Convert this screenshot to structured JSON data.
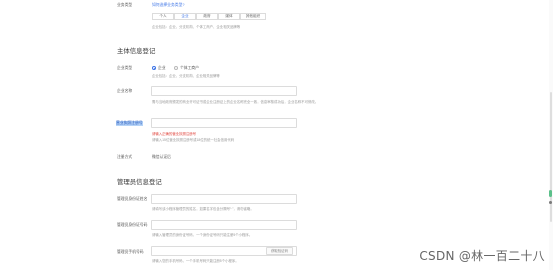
{
  "scene": {
    "business_type": {
      "label": "业务类型",
      "link": "如何选择业务类型?",
      "options": [
        "个人",
        "企业",
        "政府",
        "媒体",
        "其他组织"
      ],
      "help": "企业包括：企业、分支机构、个体工商户、企业相关品牌等"
    },
    "subject_section": {
      "title": "主体信息登记",
      "type_label": "企业类型",
      "type_options": [
        "企业",
        "个体工商户"
      ],
      "type_help": "企业包括：企业、分支机构、企业相关品牌等",
      "name_label": "企业名称",
      "name_help": "需与当地政府颁发的商业许可证书或企业注册证上的企业名称完全一致，信息审核成功后，企业名称不可修改。",
      "code_label": "营业执照注册号",
      "code_error": "请输入正确的营业执照注册号",
      "code_help": "请输入15位营业执照注册号或18位的统一社会信用代码",
      "verify_label": "注册方式",
      "verify_value": "微信认证后"
    },
    "admin_section": {
      "title": "管理员信息登记",
      "name_label": "管理员身份证姓名",
      "name_help": "请填写该小程序管理员的姓名，如果名字包含分隔号“·”，请勿省略。",
      "id_label": "管理员身份证号码",
      "id_help": "请输入管理员的身份证号码，一个身份证号码只能注册5个小程序。",
      "phone_label": "管理员手机号码",
      "phone_button": "获取验证码",
      "phone_help": "请输入您的手机号码，一个手机号码只能注册5个小程序。"
    },
    "watermark": "CSDN @林一百二十八"
  },
  "colors": {
    "accent": "#3b73e6",
    "error": "#e0423a",
    "highlight": "#b5d3f7"
  }
}
